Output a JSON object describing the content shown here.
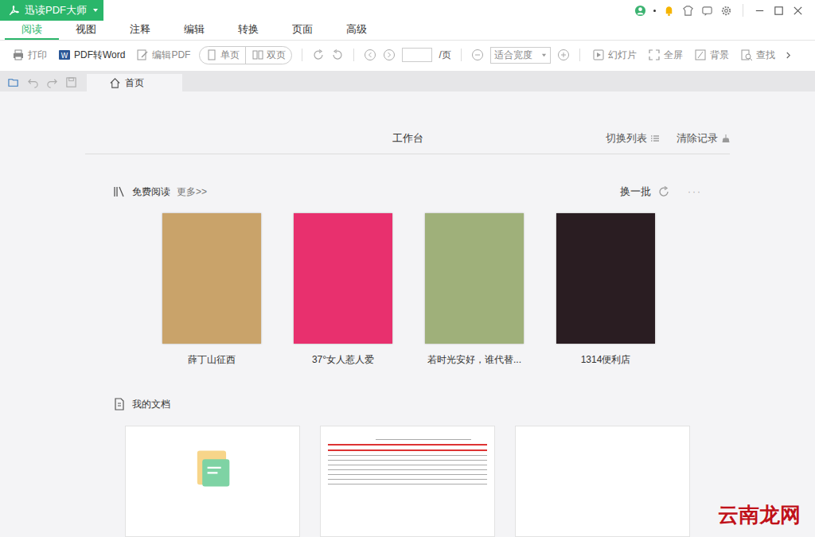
{
  "window": {
    "title": "迅读PDF大师"
  },
  "menu_tabs": [
    {
      "label": "阅读",
      "selected": true
    },
    {
      "label": "视图",
      "selected": false
    },
    {
      "label": "注释",
      "selected": false
    },
    {
      "label": "编辑",
      "selected": false
    },
    {
      "label": "转换",
      "selected": false
    },
    {
      "label": "页面",
      "selected": false
    },
    {
      "label": "高级",
      "selected": false
    }
  ],
  "toolbar": {
    "actions": [
      {
        "label": "打印",
        "disabled": true
      },
      {
        "label": "PDF转Word",
        "disabled": false
      },
      {
        "label": "编辑PDF",
        "disabled": true
      }
    ],
    "view_modes": [
      {
        "label": "单页",
        "disabled": true
      },
      {
        "label": "双页",
        "disabled": true
      }
    ],
    "page": {
      "value": "",
      "suffix": "/页"
    },
    "zoom": {
      "value": "适合宽度"
    },
    "tools": [
      {
        "label": "幻灯片",
        "disabled": true
      },
      {
        "label": "全屏",
        "disabled": true
      },
      {
        "label": "背景",
        "disabled": true
      },
      {
        "label": "查找",
        "disabled": true
      }
    ]
  },
  "doc_tabs": [
    {
      "label": "首页",
      "selected": true
    }
  ],
  "workbench": {
    "title": "工作台",
    "switch_view": "切换列表",
    "clear": "清除记录"
  },
  "free_reading": {
    "title": "免费阅读",
    "more": "更多>>",
    "refresh": "换一批",
    "options": "···",
    "books": [
      {
        "title": "薛丁山征西",
        "color": "#c9a36a"
      },
      {
        "title": "37°女人惹人爱",
        "color": "#e8306e"
      },
      {
        "title": "若时光安好，谁代替...",
        "color": "#9fb07a"
      },
      {
        "title": "1314便利店",
        "color": "#2a1d22"
      }
    ]
  },
  "my_docs": {
    "title": "我的文档",
    "docs": [
      {
        "kind": "empty"
      },
      {
        "kind": "document"
      },
      {
        "kind": "blank"
      }
    ]
  },
  "watermark": "云南龙网"
}
